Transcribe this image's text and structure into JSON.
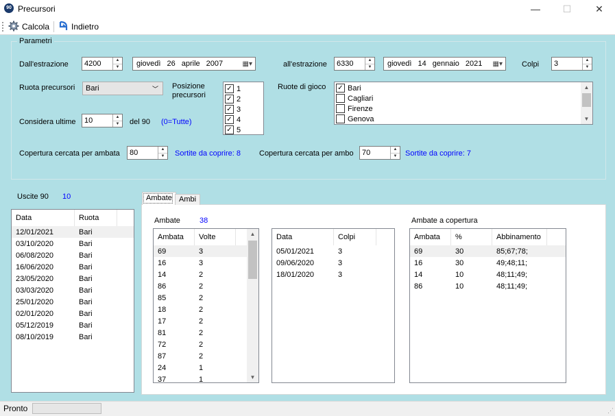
{
  "window": {
    "title": "Precursori",
    "icon_text": "90",
    "min": "—",
    "max": "☐",
    "close": "✕"
  },
  "toolbar": {
    "calcola": "Calcola",
    "indietro": "Indietro"
  },
  "params": {
    "group_title": "Parametri",
    "dall_label": "Dall'estrazione",
    "dall_value": "4200",
    "date1": {
      "weekday": "giovedì",
      "day": "26",
      "month": "aprile",
      "year": "2007"
    },
    "all_label": "all'estrazione",
    "all_value": "6330",
    "date2": {
      "weekday": "giovedì",
      "day": "14",
      "month": "gennaio",
      "year": "2021"
    },
    "colpi_label": "Colpi",
    "colpi_value": "3",
    "ruota_label": "Ruota precursori",
    "ruota_value": "Bari",
    "posizione_label1": "Posizione",
    "posizione_label2": "precursori",
    "posizioni": [
      {
        "label": "1",
        "checked": true
      },
      {
        "label": "2",
        "checked": true
      },
      {
        "label": "3",
        "checked": true
      },
      {
        "label": "4",
        "checked": true
      },
      {
        "label": "5",
        "checked": true
      }
    ],
    "ruote_gioco_label": "Ruote di gioco",
    "ruote_gioco": [
      {
        "label": "Bari",
        "checked": true
      },
      {
        "label": "Cagliari",
        "checked": false
      },
      {
        "label": "Firenze",
        "checked": false
      },
      {
        "label": "Genova",
        "checked": false
      }
    ],
    "considera_label": "Considera ultime",
    "considera_value": "10",
    "del90_label": "del 90",
    "tutte_note": "(0=Tutte)",
    "cop_ambata_label": "Copertura cercata per ambata",
    "cop_ambata_value": "80",
    "sortite_ambata": "Sortite da coprire: 8",
    "cop_ambo_label": "Copertura cercata per ambo",
    "cop_ambo_value": "70",
    "sortite_ambo": "Sortite da coprire: 7"
  },
  "uscite": {
    "label": "Uscite 90",
    "count": "10",
    "columns": [
      "Data",
      "Ruota"
    ],
    "rows": [
      [
        "12/01/2021",
        "Bari"
      ],
      [
        "03/10/2020",
        "Bari"
      ],
      [
        "06/08/2020",
        "Bari"
      ],
      [
        "16/06/2020",
        "Bari"
      ],
      [
        "23/05/2020",
        "Bari"
      ],
      [
        "03/03/2020",
        "Bari"
      ],
      [
        "25/01/2020",
        "Bari"
      ],
      [
        "02/01/2020",
        "Bari"
      ],
      [
        "05/12/2019",
        "Bari"
      ],
      [
        "08/10/2019",
        "Bari"
      ]
    ]
  },
  "tabs": {
    "ambate": "Ambate",
    "ambi": "Ambi"
  },
  "ambate_panel": {
    "label": "Ambate",
    "count": "38",
    "columns": [
      "Ambata",
      "Volte"
    ],
    "rows": [
      [
        "69",
        "3"
      ],
      [
        "16",
        "3"
      ],
      [
        "14",
        "2"
      ],
      [
        "86",
        "2"
      ],
      [
        "85",
        "2"
      ],
      [
        "18",
        "2"
      ],
      [
        "17",
        "2"
      ],
      [
        "81",
        "2"
      ],
      [
        "72",
        "2"
      ],
      [
        "87",
        "2"
      ],
      [
        "24",
        "1"
      ],
      [
        "37",
        "1"
      ]
    ]
  },
  "colpi_list": {
    "columns": [
      "Data",
      "Colpi"
    ],
    "rows": [
      [
        "05/01/2021",
        "3"
      ],
      [
        "09/06/2020",
        "3"
      ],
      [
        "18/01/2020",
        "3"
      ]
    ]
  },
  "copertura": {
    "label": "Ambate a copertura",
    "columns": [
      "Ambata",
      "%",
      "Abbinamento"
    ],
    "rows": [
      [
        "69",
        "30",
        "85;67;78;"
      ],
      [
        "16",
        "30",
        "49;48;11;"
      ],
      [
        "14",
        "10",
        "48;11;49;"
      ],
      [
        "86",
        "10",
        "48;11;49;"
      ]
    ]
  },
  "status": {
    "text": "Pronto"
  }
}
